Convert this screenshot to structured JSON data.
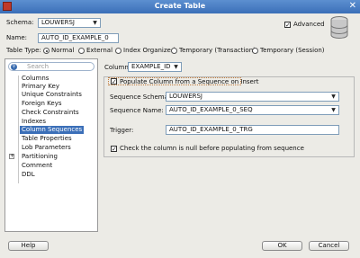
{
  "window": {
    "title": "Create Table"
  },
  "schema": {
    "label": "Schema:",
    "value": "LOUWERSJ"
  },
  "advanced": {
    "label": "Advanced",
    "checked": true
  },
  "name": {
    "label": "Name:",
    "value": "AUTO_ID_EXAMPLE_0"
  },
  "table_type": {
    "label": "Table Type:",
    "options": [
      "Normal",
      "External",
      "Index Organized",
      "Temporary (Transaction)",
      "Temporary (Session)"
    ],
    "selected": "Normal"
  },
  "search": {
    "placeholder": "Search"
  },
  "nav": {
    "items": [
      "Columns",
      "Primary Key",
      "Unique Constraints",
      "Foreign Keys",
      "Check Constraints",
      "Indexes",
      "Column Sequences",
      "Table Properties",
      "Lob Parameters",
      "Partitioning",
      "Comment",
      "DDL"
    ],
    "selected": "Column Sequences"
  },
  "column": {
    "label": "Column:",
    "value": "EXAMPLE_ID"
  },
  "populate": {
    "label": "Populate Column from a Sequence on Insert",
    "checked": true
  },
  "sequence_schema": {
    "label": "Sequence Schema:",
    "value": "LOUWERSJ"
  },
  "sequence_name": {
    "label": "Sequence Name:",
    "value": "AUTO_ID_EXAMPLE_0_SEQ"
  },
  "trigger": {
    "label": "Trigger:",
    "value": "AUTO_ID_EXAMPLE_0_TRG"
  },
  "null_check": {
    "label": "Check the column is null before populating from sequence",
    "checked": true
  },
  "buttons": {
    "help": "Help",
    "ok": "OK",
    "cancel": "Cancel"
  }
}
